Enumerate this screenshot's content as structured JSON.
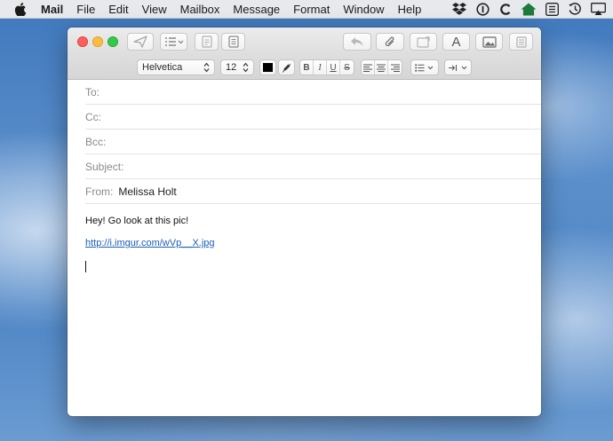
{
  "menubar": {
    "app_name": "Mail",
    "items": [
      "File",
      "Edit",
      "View",
      "Mailbox",
      "Message",
      "Format",
      "Window",
      "Help"
    ],
    "status_icons": [
      "dropbox-icon",
      "1password-icon",
      "c-app-icon",
      "home-icon",
      "keyboard-icon",
      "time-machine-icon",
      "airplay-icon"
    ]
  },
  "toolbar": {
    "buttons": [
      "send-icon",
      "header-fields-icon",
      "attach-doc-icon",
      "notes-icon",
      "reply-icon",
      "paperclip-icon",
      "markup-icon",
      "font-icon",
      "photo-browser-icon",
      "template-icon"
    ],
    "font_button_glyph": "A"
  },
  "format": {
    "font_family": "Helvetica",
    "font_size": "12",
    "text_color": "#000000",
    "style_buttons": [
      "B",
      "I",
      "U",
      "S"
    ]
  },
  "compose": {
    "to_label": "To:",
    "cc_label": "Cc:",
    "bcc_label": "Bcc:",
    "subject_label": "Subject:",
    "from_label": "From:",
    "from_value": "Melissa Holt",
    "to_value": "",
    "cc_value": "",
    "bcc_value": "",
    "subject_value": ""
  },
  "body": {
    "line1": "Hey! Go look at this pic!",
    "link": "http://i.imgur.com/wVp__X.jpg"
  }
}
